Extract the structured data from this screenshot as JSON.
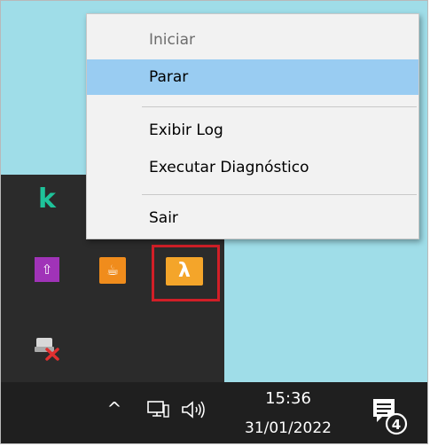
{
  "context_menu": {
    "items": [
      {
        "label": "Iniciar",
        "state": "disabled"
      },
      {
        "label": "Parar",
        "state": "highlighted"
      },
      {
        "label": "Exibir Log",
        "state": "normal"
      },
      {
        "label": "Executar Diagnóstico",
        "state": "normal"
      },
      {
        "label": "Sair",
        "state": "normal"
      }
    ]
  },
  "tray": {
    "icons": [
      "kaspersky-k-icon",
      "purple-app-icon",
      "java-icon",
      "lambda-app-icon",
      "network-error-icon"
    ],
    "selected_icon": "lambda-app-icon"
  },
  "taskbar": {
    "time": "15:36",
    "date": "31/01/2022",
    "notification_count": "4",
    "icons": [
      "chevron-up-icon",
      "network-monitor-icon",
      "speaker-icon",
      "notification-icon"
    ]
  },
  "colors": {
    "desktop": "#9fdde8",
    "tray_panel": "#2b2b2b",
    "taskbar": "#1f1f1f",
    "menu_bg": "#f2f2f2",
    "menu_highlight": "#99ccf2",
    "highlight_border": "#d11f27",
    "lambda_icon": "#f4a52a"
  }
}
